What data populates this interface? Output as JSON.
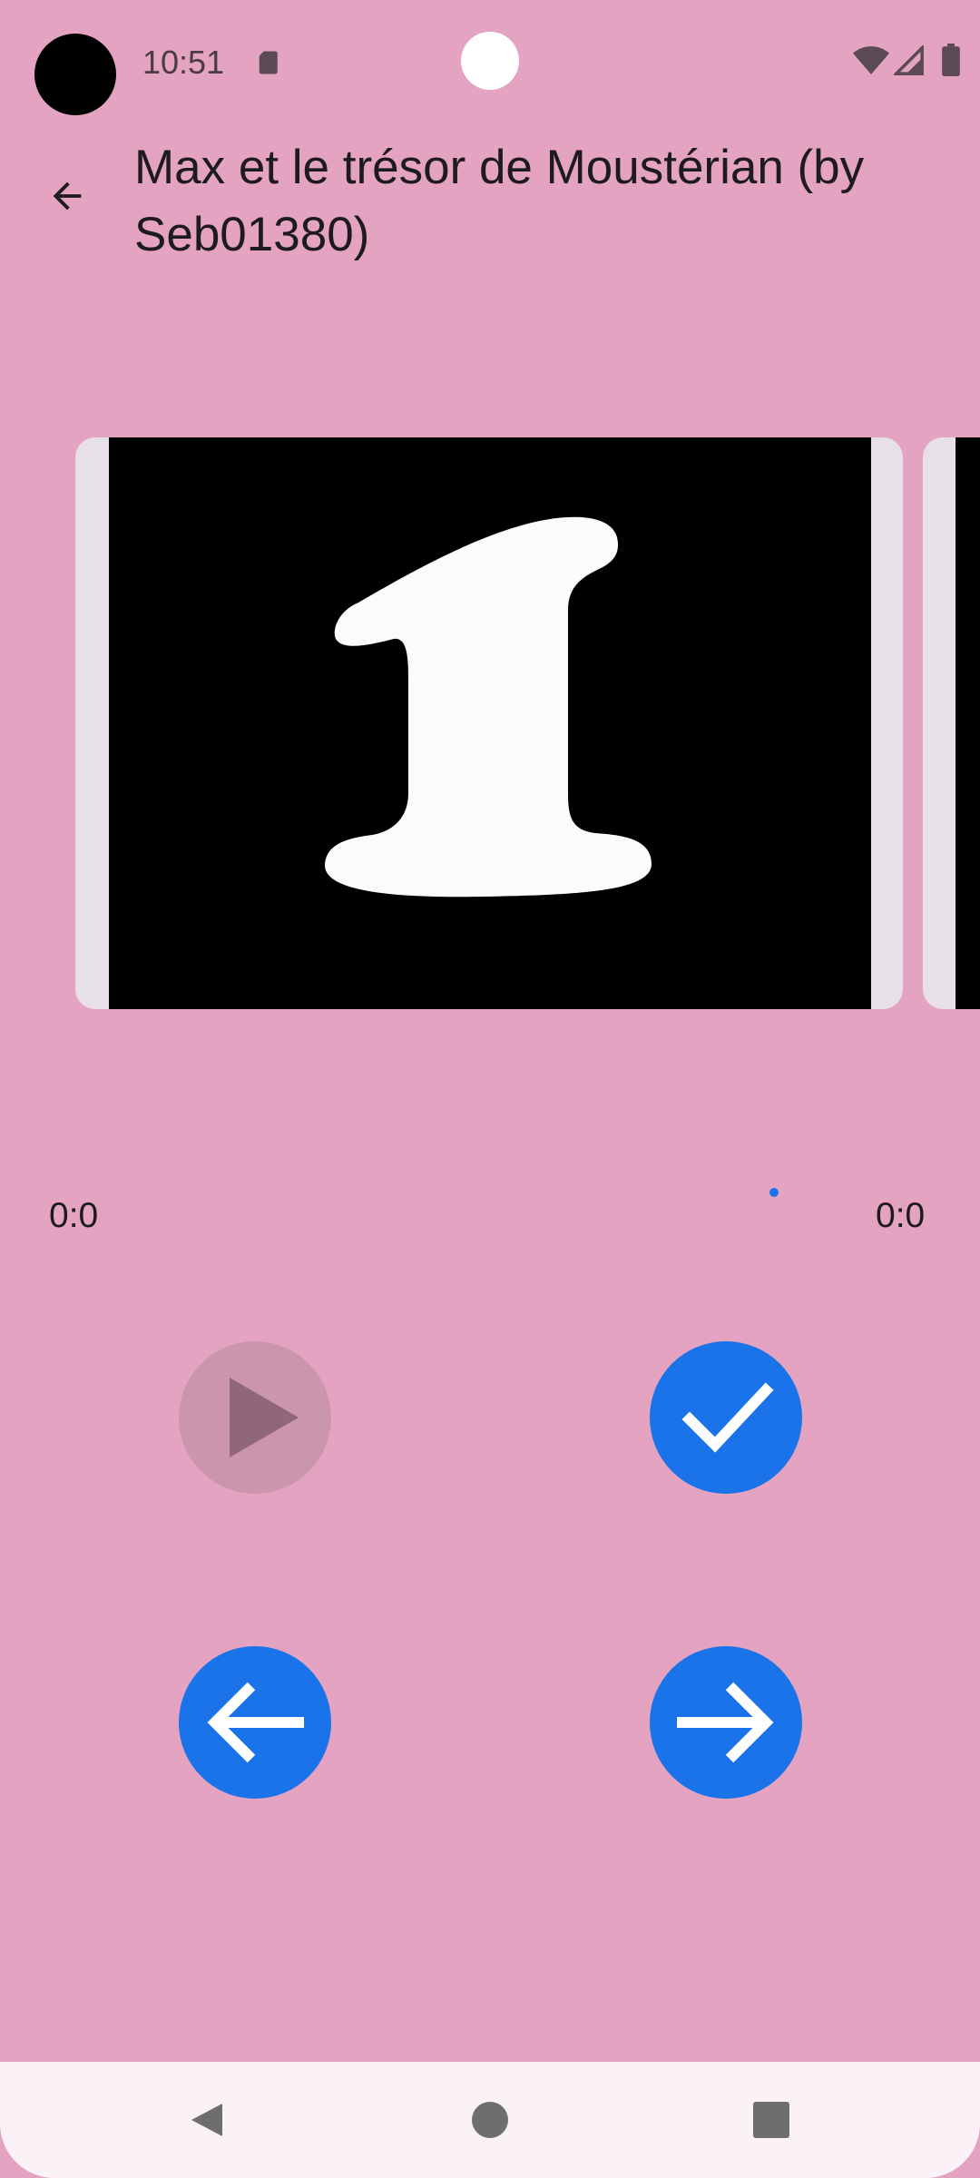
{
  "status_bar": {
    "time": "10:51",
    "icons": [
      "sd-card-icon",
      "wifi-icon",
      "signal-icon",
      "battery-icon"
    ]
  },
  "app_bar": {
    "back_icon": "arrow-back-icon",
    "title": "Max et le trésor de Moustérian (by Seb01380)"
  },
  "player": {
    "current_time": "0:0",
    "total_time": "0:0",
    "progress": 0.84,
    "buttons": {
      "play": {
        "icon": "play-icon",
        "enabled": false
      },
      "ok": {
        "icon": "check-icon",
        "enabled": true
      },
      "previous": {
        "icon": "arrow-left-icon",
        "enabled": true
      },
      "next": {
        "icon": "arrow-right-icon",
        "enabled": true
      }
    }
  },
  "nav_bar": {
    "icons": [
      "nav-back-icon",
      "nav-home-icon",
      "nav-recents-icon"
    ]
  },
  "colors": {
    "background": "#e4a3c1",
    "accent": "#1a73e8",
    "disabled_button": "#cc95ae",
    "card": "#e7e0e8",
    "nav_bar": "#faf2f6"
  }
}
